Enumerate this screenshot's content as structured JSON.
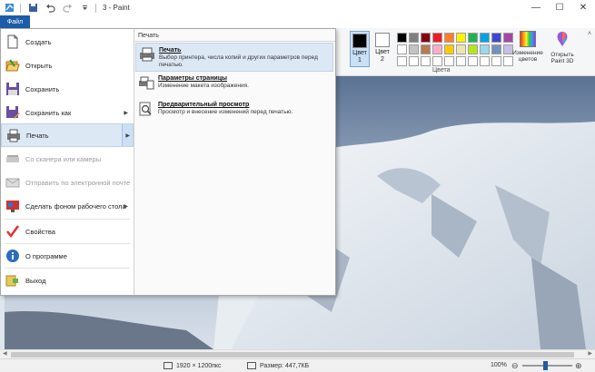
{
  "window": {
    "title": "3 - Paint",
    "buttons": {
      "minimize": "—",
      "maximize": "☐",
      "close": "✕"
    }
  },
  "ribbon": {
    "file_tab": "Файл",
    "color1_label": "Цвет 1",
    "color2_label": "Цвет 2",
    "colors_group_label": "Цвета",
    "edit_colors_label": "Изменение цветов",
    "open_paint3d_label": "Открыть Paint 3D",
    "palette_row1": [
      "#000000",
      "#7f7f7f",
      "#880015",
      "#ed1c24",
      "#ff7f27",
      "#fff200",
      "#22b14c",
      "#00a2e8",
      "#3f48cc",
      "#a349a4"
    ],
    "palette_row2": [
      "#ffffff",
      "#c3c3c3",
      "#b97a57",
      "#ffaec9",
      "#ffc90e",
      "#efe4b0",
      "#b5e61d",
      "#99d9ea",
      "#7092be",
      "#c8bfe7"
    ],
    "palette_row3": [
      "#ffffff",
      "#ffffff",
      "#ffffff",
      "#ffffff",
      "#ffffff",
      "#ffffff",
      "#ffffff",
      "#ffffff",
      "#ffffff",
      "#ffffff"
    ]
  },
  "file_menu": {
    "items": [
      {
        "label": "Создать"
      },
      {
        "label": "Открыть"
      },
      {
        "label": "Сохранить"
      },
      {
        "label": "Сохранить как"
      },
      {
        "label": "Печать"
      },
      {
        "label": "Со сканера или камеры"
      },
      {
        "label": "Отправить по электронной почте"
      },
      {
        "label": "Сделать фоном рабочего стола"
      },
      {
        "label": "Свойства"
      },
      {
        "label": "О программе"
      },
      {
        "label": "Выход"
      }
    ],
    "submenu": {
      "header": "Печать",
      "items": [
        {
          "title": "Печать",
          "desc": "Выбор принтера, числа копий и других параметров перед печатью."
        },
        {
          "title": "Параметры страницы",
          "desc": "Изменение макета изображения."
        },
        {
          "title": "Предварительный просмотр",
          "desc": "Просмотр и внесение изменений перед печатью."
        }
      ]
    }
  },
  "statusbar": {
    "dimensions": "1920 × 1200пкс",
    "size": "Размер: 447,7КБ",
    "zoom": "100%"
  }
}
